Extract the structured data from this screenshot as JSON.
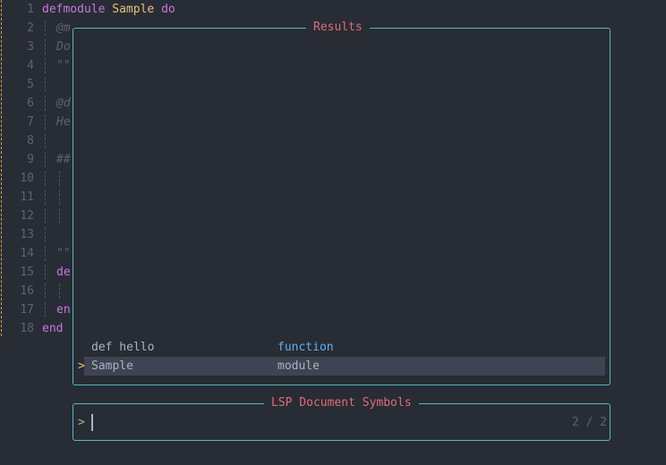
{
  "editor": {
    "lines": [
      {
        "num": "1",
        "parts": [
          {
            "t": "defmodule",
            "c": "kw"
          },
          {
            "t": " "
          },
          {
            "t": "Sample",
            "c": "mod"
          },
          {
            "t": " "
          },
          {
            "t": "do",
            "c": "kw"
          }
        ]
      },
      {
        "num": "2",
        "guides": 1,
        "parts": [
          {
            "t": "@m",
            "c": "cmt"
          }
        ]
      },
      {
        "num": "3",
        "guides": 1,
        "parts": [
          {
            "t": "Do",
            "c": "cmt"
          }
        ]
      },
      {
        "num": "4",
        "guides": 1,
        "parts": [
          {
            "t": "\"\"",
            "c": "str"
          }
        ]
      },
      {
        "num": "5",
        "guides": 1,
        "parts": []
      },
      {
        "num": "6",
        "guides": 1,
        "parts": [
          {
            "t": "@d",
            "c": "cmt"
          }
        ]
      },
      {
        "num": "7",
        "guides": 1,
        "parts": [
          {
            "t": "He",
            "c": "cmt"
          }
        ]
      },
      {
        "num": "8",
        "guides": 1,
        "parts": []
      },
      {
        "num": "9",
        "guides": 1,
        "parts": [
          {
            "t": "##",
            "c": "cmt"
          }
        ]
      },
      {
        "num": "10",
        "guides": 2,
        "parts": []
      },
      {
        "num": "11",
        "guides": 2,
        "parts": []
      },
      {
        "num": "12",
        "guides": 2,
        "parts": []
      },
      {
        "num": "13",
        "guides": 1,
        "parts": []
      },
      {
        "num": "14",
        "guides": 1,
        "parts": [
          {
            "t": "\"\"",
            "c": "str"
          }
        ]
      },
      {
        "num": "15",
        "guides": 1,
        "parts": [
          {
            "t": "de",
            "c": "kw"
          }
        ]
      },
      {
        "num": "16",
        "guides": 2,
        "parts": []
      },
      {
        "num": "17",
        "guides": 1,
        "parts": [
          {
            "t": "en",
            "c": "kw"
          }
        ]
      },
      {
        "num": "18",
        "parts": [
          {
            "t": "end",
            "c": "kw"
          }
        ]
      }
    ]
  },
  "results": {
    "title": "Results",
    "items": [
      {
        "name": "def hello",
        "kind": "function",
        "selected": false
      },
      {
        "name": "Sample",
        "kind": "module",
        "selected": true
      }
    ],
    "selected_marker": ">"
  },
  "prompt": {
    "title": "LSP Document Symbols",
    "caret": ">",
    "counter": "2 / 2",
    "value": ""
  },
  "colors": {
    "background": "#282c34",
    "border": "#56b6c2",
    "title": "#e06c75",
    "keyword": "#c678dd",
    "module": "#e5c07b",
    "function_kind": "#61afef",
    "selection": "#3e4451"
  }
}
